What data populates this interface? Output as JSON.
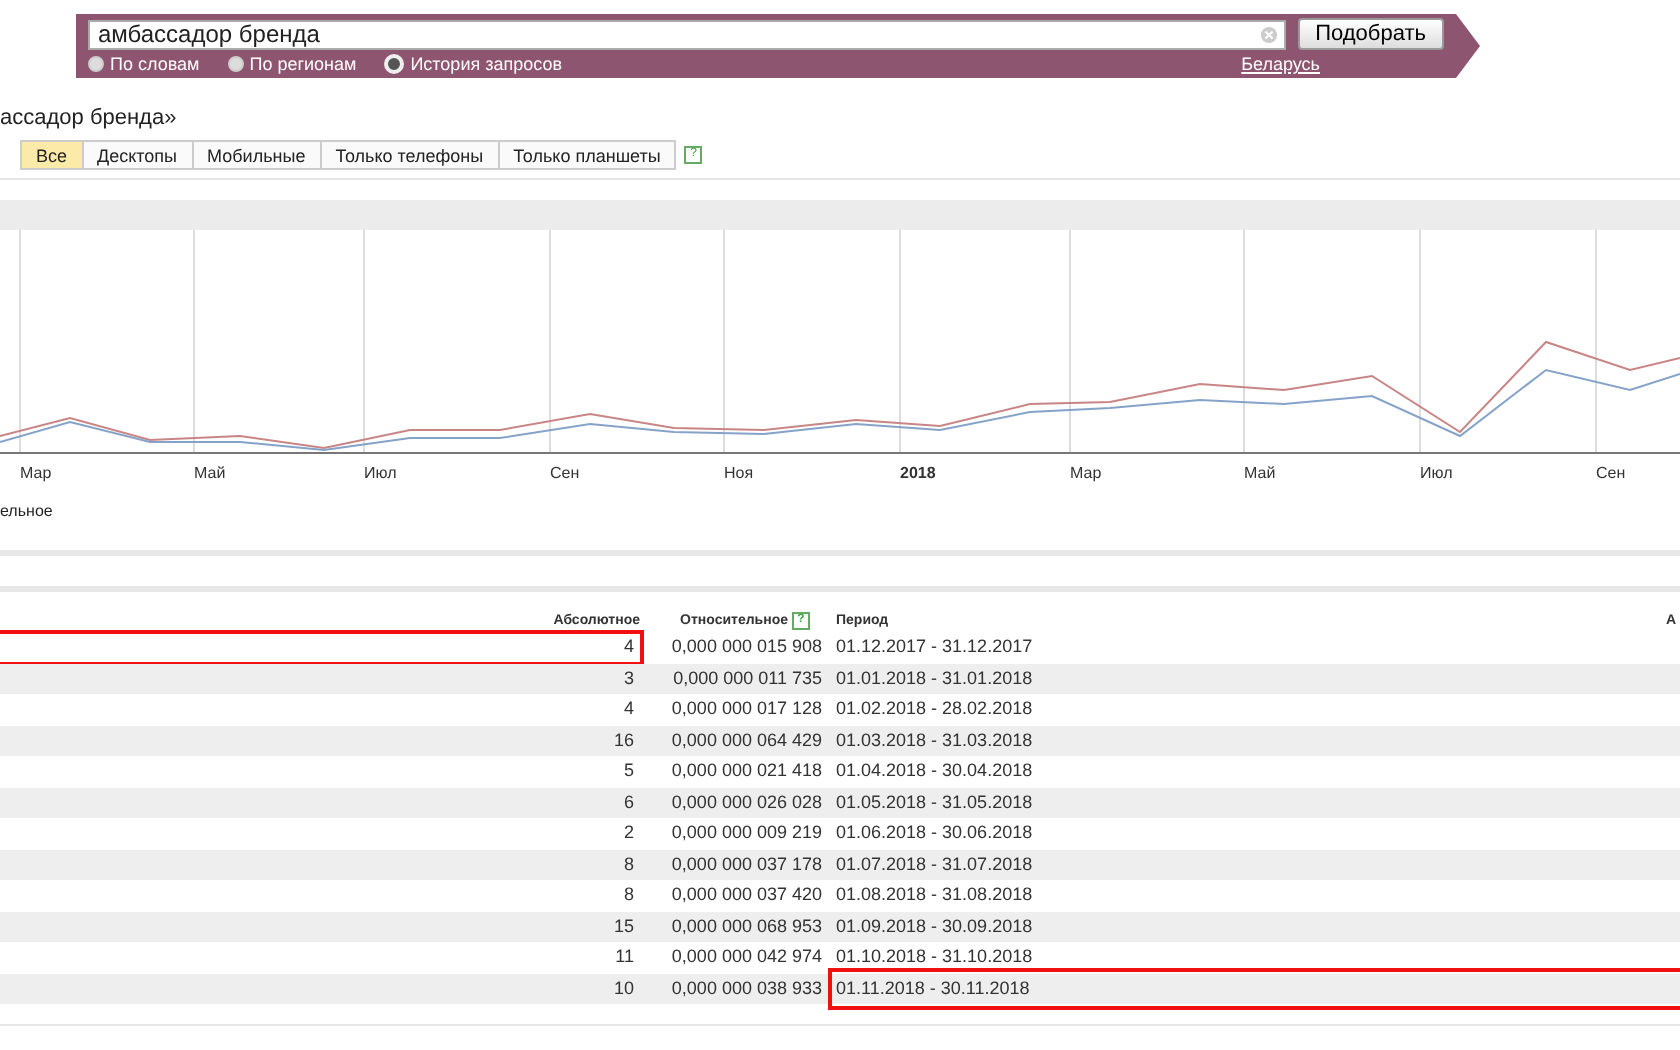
{
  "search": {
    "value": "амбассадор бренда",
    "submit": "Подобрать",
    "modes": [
      {
        "label": "По словам",
        "selected": false
      },
      {
        "label": "По регионам",
        "selected": false
      },
      {
        "label": "История запросов",
        "selected": true
      }
    ],
    "region": "Беларусь"
  },
  "heading": "ассадор бренда»",
  "device_tabs": [
    {
      "label": "Все",
      "selected": true
    },
    {
      "label": "Десктопы",
      "selected": false
    },
    {
      "label": "Мобильные",
      "selected": false
    },
    {
      "label": "Только телефоны",
      "selected": false
    },
    {
      "label": "Только планшеты",
      "selected": false
    }
  ],
  "help_mark": "?",
  "chart": {
    "x_labels": [
      {
        "label": "Мар",
        "bold": false
      },
      {
        "label": "Май",
        "bold": false
      },
      {
        "label": "Июл",
        "bold": false
      },
      {
        "label": "Сен",
        "bold": false
      },
      {
        "label": "Ноя",
        "bold": false
      },
      {
        "label": "2018",
        "bold": true
      },
      {
        "label": "Мар",
        "bold": false
      },
      {
        "label": "Май",
        "bold": false
      },
      {
        "label": "Июл",
        "bold": false
      },
      {
        "label": "Сен",
        "bold": false
      }
    ],
    "legend": "ельное"
  },
  "table": {
    "columns": [
      "Абсолютное",
      "Относительное",
      "Период",
      "А"
    ],
    "help_mark": "?",
    "rows": [
      {
        "absolute": "4",
        "relative": "0,000 000 015 908",
        "period": "01.12.2017 - 31.12.2017",
        "count_highlighted": true
      },
      {
        "absolute": "3",
        "relative": "0,000 000 011 735",
        "period": "01.01.2018 - 31.01.2018"
      },
      {
        "absolute": "4",
        "relative": "0,000 000 017 128",
        "period": "01.02.2018 - 28.02.2018"
      },
      {
        "absolute": "16",
        "relative": "0,000 000 064 429",
        "period": "01.03.2018 - 31.03.2018"
      },
      {
        "absolute": "5",
        "relative": "0,000 000 021 418",
        "period": "01.04.2018 - 30.04.2018"
      },
      {
        "absolute": "6",
        "relative": "0,000 000 026 028",
        "period": "01.05.2018 - 31.05.2018"
      },
      {
        "absolute": "2",
        "relative": "0,000 000 009 219",
        "period": "01.06.2018 - 30.06.2018"
      },
      {
        "absolute": "8",
        "relative": "0,000 000 037 178",
        "period": "01.07.2018 - 31.07.2018"
      },
      {
        "absolute": "8",
        "relative": "0,000 000 037 420",
        "period": "01.08.2018 - 31.08.2018"
      },
      {
        "absolute": "15",
        "relative": "0,000 000 068 953",
        "period": "01.09.2018 - 30.09.2018"
      },
      {
        "absolute": "11",
        "relative": "0,000 000 042 974",
        "period": "01.10.2018 - 31.10.2018"
      },
      {
        "absolute": "10",
        "relative": "0,000 000 038 933",
        "period": "01.11.2018 - 30.11.2018",
        "period_highlighted": true
      }
    ]
  }
}
